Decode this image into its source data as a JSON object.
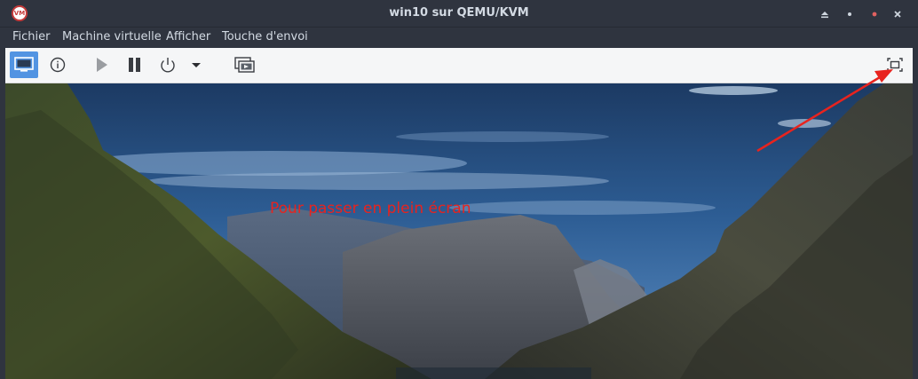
{
  "window": {
    "title": "win10 sur QEMU/KVM",
    "logo_text": "VM"
  },
  "window_controls": [
    "shade-icon",
    "minimize-icon",
    "maximize-icon",
    "close-icon"
  ],
  "menubar": {
    "items": [
      "Fichier",
      "Machine virtuelle",
      "Afficher",
      "Touche d'envoi"
    ]
  },
  "toolbar": {
    "buttons": [
      {
        "name": "console",
        "icon": "monitor-icon",
        "active": true
      },
      {
        "name": "details",
        "icon": "info-icon",
        "active": false
      },
      {
        "name": "run",
        "icon": "play-icon",
        "active": false,
        "enabled": false
      },
      {
        "name": "pause",
        "icon": "pause-icon",
        "active": false
      },
      {
        "name": "shutdown",
        "icon": "power-icon",
        "active": false
      },
      {
        "name": "shutdown-menu",
        "icon": "dropdown-arrow-icon",
        "active": false
      },
      {
        "name": "snapshots",
        "icon": "snapshots-icon",
        "active": false
      },
      {
        "name": "fullscreen",
        "icon": "fullscreen-icon",
        "active": false
      }
    ]
  },
  "annotation": {
    "text": "Pour passer en plein écran",
    "color": "#e8231e"
  },
  "colors": {
    "titlebar_bg": "#2f343f",
    "text": "#d3dae3",
    "toolbar_bg": "#f5f6f7",
    "accent": "#5294e2"
  }
}
